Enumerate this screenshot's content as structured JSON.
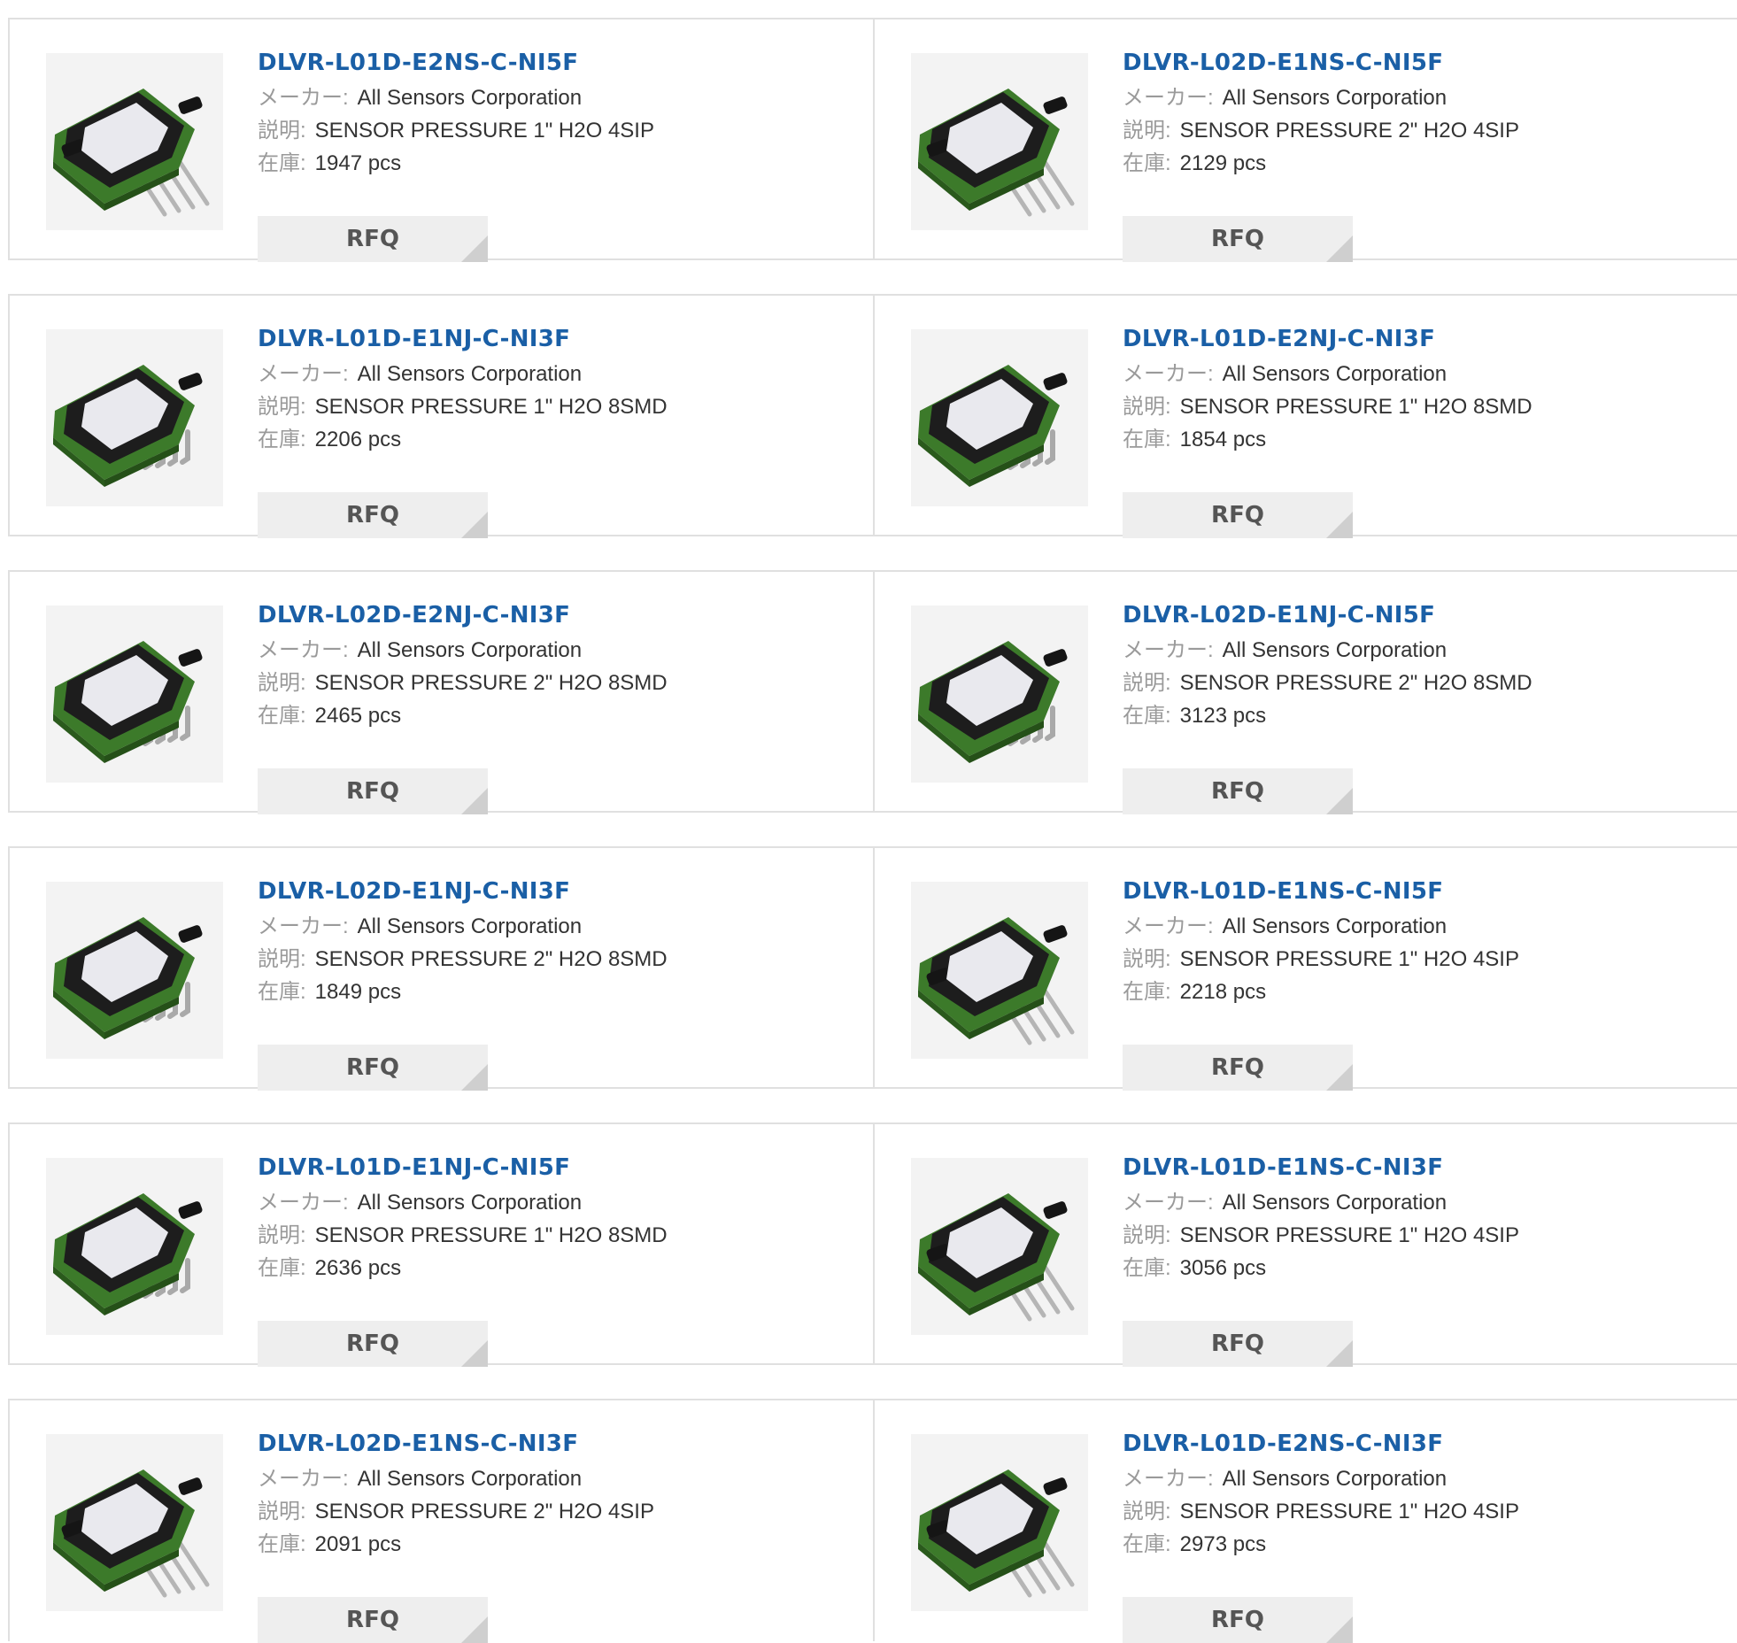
{
  "labels": {
    "maker": "メーカー",
    "description": "説明",
    "stock": "在庫",
    "separator": ":",
    "rfq": "RFQ"
  },
  "colors": {
    "part_number_link": "#1a5fa6",
    "label_gray": "#9a9a9a",
    "rfq_background": "#eeeeee",
    "border": "#e0e0e0"
  },
  "products": [
    {
      "part_number": "DLVR-L01D-E2NS-C-NI5F",
      "maker": "All Sensors Corporation",
      "description": "SENSOR PRESSURE 1\" H2O 4SIP",
      "stock": "1947 pcs",
      "package": "4SIP",
      "image_icon": "pressure-sensor-4sip-icon"
    },
    {
      "part_number": "DLVR-L02D-E1NS-C-NI5F",
      "maker": "All Sensors Corporation",
      "description": "SENSOR PRESSURE 2\" H2O 4SIP",
      "stock": "2129 pcs",
      "package": "4SIP",
      "image_icon": "pressure-sensor-4sip-icon"
    },
    {
      "part_number": "DLVR-L01D-E1NJ-C-NI3F",
      "maker": "All Sensors Corporation",
      "description": "SENSOR PRESSURE 1\" H2O 8SMD",
      "stock": "2206 pcs",
      "package": "8SMD",
      "image_icon": "pressure-sensor-8smd-icon"
    },
    {
      "part_number": "DLVR-L01D-E2NJ-C-NI3F",
      "maker": "All Sensors Corporation",
      "description": "SENSOR PRESSURE 1\" H2O 8SMD",
      "stock": "1854 pcs",
      "package": "8SMD",
      "image_icon": "pressure-sensor-8smd-icon"
    },
    {
      "part_number": "DLVR-L02D-E2NJ-C-NI3F",
      "maker": "All Sensors Corporation",
      "description": "SENSOR PRESSURE 2\" H2O 8SMD",
      "stock": "2465 pcs",
      "package": "8SMD",
      "image_icon": "pressure-sensor-8smd-icon"
    },
    {
      "part_number": "DLVR-L02D-E1NJ-C-NI5F",
      "maker": "All Sensors Corporation",
      "description": "SENSOR PRESSURE 2\" H2O 8SMD",
      "stock": "3123 pcs",
      "package": "8SMD",
      "image_icon": "pressure-sensor-8smd-icon"
    },
    {
      "part_number": "DLVR-L02D-E1NJ-C-NI3F",
      "maker": "All Sensors Corporation",
      "description": "SENSOR PRESSURE 2\" H2O 8SMD",
      "stock": "1849 pcs",
      "package": "8SMD",
      "image_icon": "pressure-sensor-8smd-icon"
    },
    {
      "part_number": "DLVR-L01D-E1NS-C-NI5F",
      "maker": "All Sensors Corporation",
      "description": "SENSOR PRESSURE 1\" H2O 4SIP",
      "stock": "2218 pcs",
      "package": "4SIP",
      "image_icon": "pressure-sensor-4sip-icon"
    },
    {
      "part_number": "DLVR-L01D-E1NJ-C-NI5F",
      "maker": "All Sensors Corporation",
      "description": "SENSOR PRESSURE 1\" H2O 8SMD",
      "stock": "2636 pcs",
      "package": "8SMD",
      "image_icon": "pressure-sensor-8smd-icon"
    },
    {
      "part_number": "DLVR-L01D-E1NS-C-NI3F",
      "maker": "All Sensors Corporation",
      "description": "SENSOR PRESSURE 1\" H2O 4SIP",
      "stock": "3056 pcs",
      "package": "4SIP",
      "image_icon": "pressure-sensor-4sip-icon"
    },
    {
      "part_number": "DLVR-L02D-E1NS-C-NI3F",
      "maker": "All Sensors Corporation",
      "description": "SENSOR PRESSURE 2\" H2O 4SIP",
      "stock": "2091 pcs",
      "package": "4SIP",
      "image_icon": "pressure-sensor-4sip-icon"
    },
    {
      "part_number": "DLVR-L01D-E2NS-C-NI3F",
      "maker": "All Sensors Corporation",
      "description": "SENSOR PRESSURE 1\" H2O 4SIP",
      "stock": "2973 pcs",
      "package": "4SIP",
      "image_icon": "pressure-sensor-4sip-icon"
    }
  ]
}
